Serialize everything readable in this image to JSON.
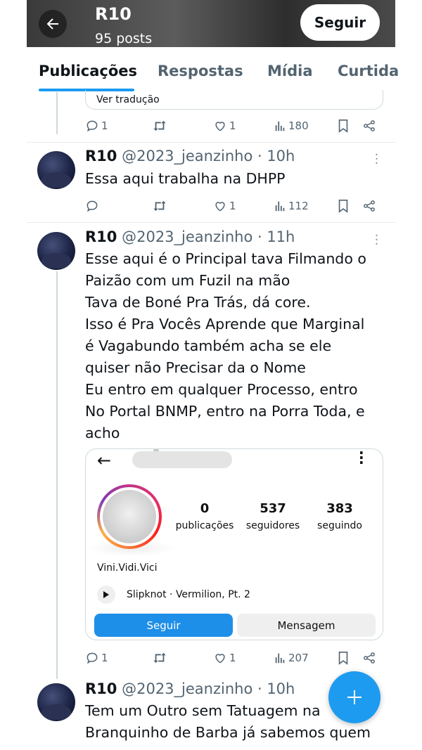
{
  "header": {
    "name": "R10",
    "posts": "95 posts",
    "follow_label": "Seguir"
  },
  "tabs": [
    {
      "label": "Publicações",
      "active": true
    },
    {
      "label": "Respostas",
      "active": false
    },
    {
      "label": "Mídia",
      "active": false
    },
    {
      "label": "Curtida",
      "active": false
    }
  ],
  "feed": {
    "top_tweet": {
      "translate_label": "Ver tradução",
      "replies": "1",
      "likes": "1",
      "views": "180"
    },
    "tweet1": {
      "name": "R10",
      "meta": "@2023_jeanzinho · 10h",
      "text_lines": [
        "Essa aqui trabalha na DHPP"
      ],
      "replies": "",
      "likes": "1",
      "views": "112"
    },
    "tweet2": {
      "name": "R10",
      "meta": "@2023_jeanzinho · 11h",
      "text_lines": [
        "Esse aqui é o Principal tava Filmando o",
        "Paizão com um Fuzil na mão",
        "Tava de Boné Pra Trás, dá core.",
        "Isso é Pra Vocês Aprende que Marginal",
        "é Vagabundo também acha se ele",
        "quiser não Precisar da o Nome",
        "Eu entro em qualquer Processo, entro",
        "No Portal BNMP, entro na Porra Toda, e",
        "acho"
      ],
      "replies": "1",
      "likes": "1",
      "views": "207",
      "profile_card": {
        "posts_count": "0",
        "posts_label": "publicações",
        "followers_count": "537",
        "followers_label": "seguidores",
        "following_count": "383",
        "following_label": "seguindo",
        "bio": "Vini.Vidi.Vici",
        "music": "Slipknot · Vermilion, Pt. 2",
        "follow_label": "Seguir",
        "message_label": "Mensagem"
      }
    },
    "tweet3": {
      "name": "R10",
      "meta": "@2023_jeanzinho · 10h",
      "text_lines": [
        "Tem um Outro sem Tatuagem na",
        "Branquinho de Barba já sabemos quem"
      ]
    }
  },
  "colors": {
    "accent": "#1d9bf0",
    "text": "#0f1419",
    "secondary": "#536471",
    "ig_follow": "#1e8fe8"
  },
  "icons": {
    "fab": "plus-icon",
    "back": "arrow-left-icon"
  }
}
